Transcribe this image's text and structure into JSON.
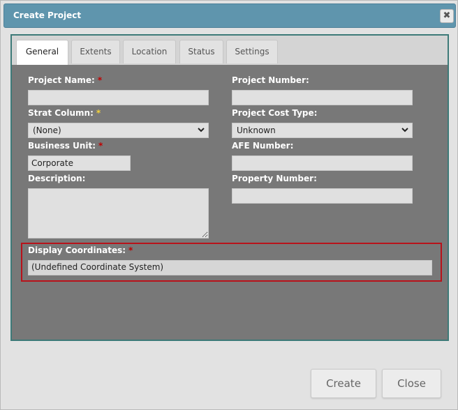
{
  "dialog": {
    "title": "Create Project",
    "close_glyph": "✖"
  },
  "tabs": [
    {
      "label": "General",
      "active": true
    },
    {
      "label": "Extents"
    },
    {
      "label": "Location"
    },
    {
      "label": "Status"
    },
    {
      "label": "Settings"
    }
  ],
  "form": {
    "project_name": {
      "label": "Project Name:",
      "required_mark": "*",
      "value": ""
    },
    "project_number": {
      "label": "Project Number:",
      "value": ""
    },
    "strat_column": {
      "label": "Strat Column:",
      "required_mark": "*",
      "value": "(None)"
    },
    "project_cost_type": {
      "label": "Project Cost Type:",
      "value": "Unknown"
    },
    "business_unit": {
      "label": "Business Unit:",
      "required_mark": "*",
      "value": "Corporate"
    },
    "afe_number": {
      "label": "AFE Number:",
      "value": ""
    },
    "description": {
      "label": "Description:",
      "value": ""
    },
    "property_number": {
      "label": "Property Number:",
      "value": ""
    },
    "display_coordinates": {
      "label": "Display Coordinates:",
      "required_mark": "*",
      "value": "(Undefined Coordinate System)"
    }
  },
  "buttons": {
    "create": "Create",
    "close": "Close"
  },
  "colors": {
    "title_bar": "#5f95ad",
    "panel": "#787878",
    "panel_border": "#3d7a78",
    "highlight_border": "#b8121a",
    "required_red": "#c00000",
    "required_yellow": "#f3d23a"
  }
}
